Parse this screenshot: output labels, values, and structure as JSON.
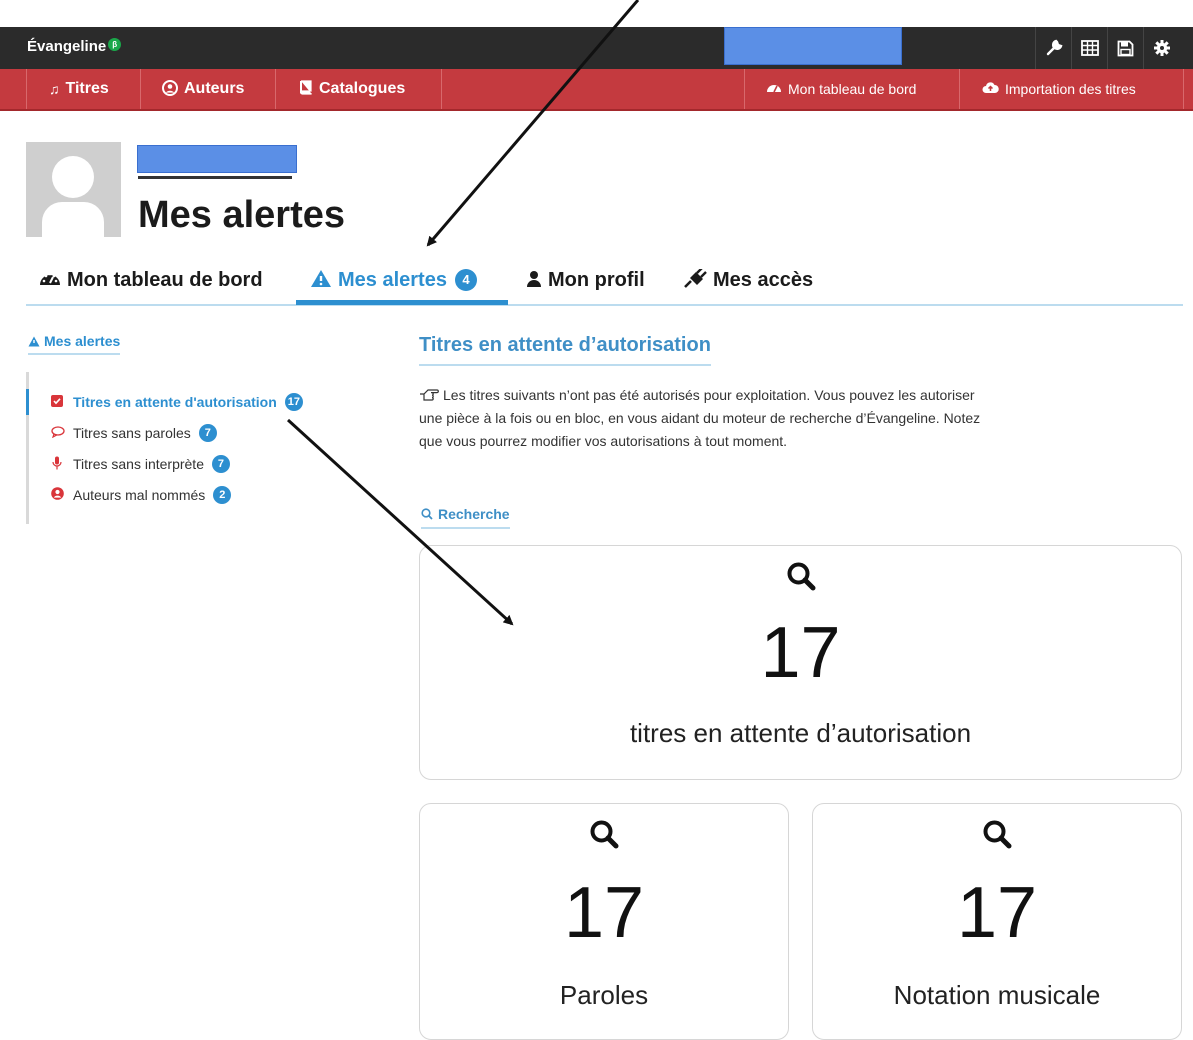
{
  "topbar": {
    "brand": "Évangeline",
    "brand_badge": "β",
    "tools": [
      "wrench-icon",
      "grid-icon",
      "save-icon",
      "gear-icon"
    ]
  },
  "rednav": {
    "left": [
      {
        "icon": "music-icon",
        "label": "Titres"
      },
      {
        "icon": "user-circle-icon",
        "label": "Auteurs"
      },
      {
        "icon": "book-icon",
        "label": "Catalogues"
      }
    ],
    "right": [
      {
        "icon": "dashboard-icon",
        "label": "Mon tableau de bord"
      },
      {
        "icon": "cloud-upload-icon",
        "label": "Importation des titres"
      }
    ]
  },
  "header": {
    "title": "Mes alertes"
  },
  "tabs": [
    {
      "icon": "dashboard-icon",
      "label": "Mon tableau de bord"
    },
    {
      "icon": "warning-icon",
      "label": "Mes alertes",
      "badge": "4",
      "active": true
    },
    {
      "icon": "user-icon",
      "label": "Mon profil"
    },
    {
      "icon": "plug-icon",
      "label": "Mes accès"
    }
  ],
  "sidebar": {
    "heading": "Mes alertes",
    "items": [
      {
        "icon": "checkbox-icon",
        "label": "Titres en attente d'autorisation",
        "badge": "17",
        "active": true
      },
      {
        "icon": "speech-bubble-icon",
        "label": "Titres sans paroles",
        "badge": "7"
      },
      {
        "icon": "microphone-icon",
        "label": "Titres sans interprète",
        "badge": "7"
      },
      {
        "icon": "user-alert-icon",
        "label": "Auteurs mal nommés",
        "badge": "2"
      }
    ]
  },
  "main": {
    "heading": "Titres en attente d’autorisation",
    "description": "Les titres suivants n’ont pas été autorisés pour exploitation. Vous pouvez les autoriser une pièce à la fois ou en bloc, en vous aidant du moteur de recherche d’Évangeline. Notez que vous pourrez modifier vos autorisations à tout moment.",
    "search_heading": "Recherche",
    "cards": [
      {
        "value": "17",
        "label": "titres en attente d’autorisation"
      },
      {
        "value": "17",
        "label": "Paroles"
      },
      {
        "value": "17",
        "label": "Notation musicale"
      }
    ]
  },
  "colors": {
    "accent": "#2d8fd0",
    "nav_red": "#c43a3f",
    "topbar": "#2b2b2b"
  }
}
